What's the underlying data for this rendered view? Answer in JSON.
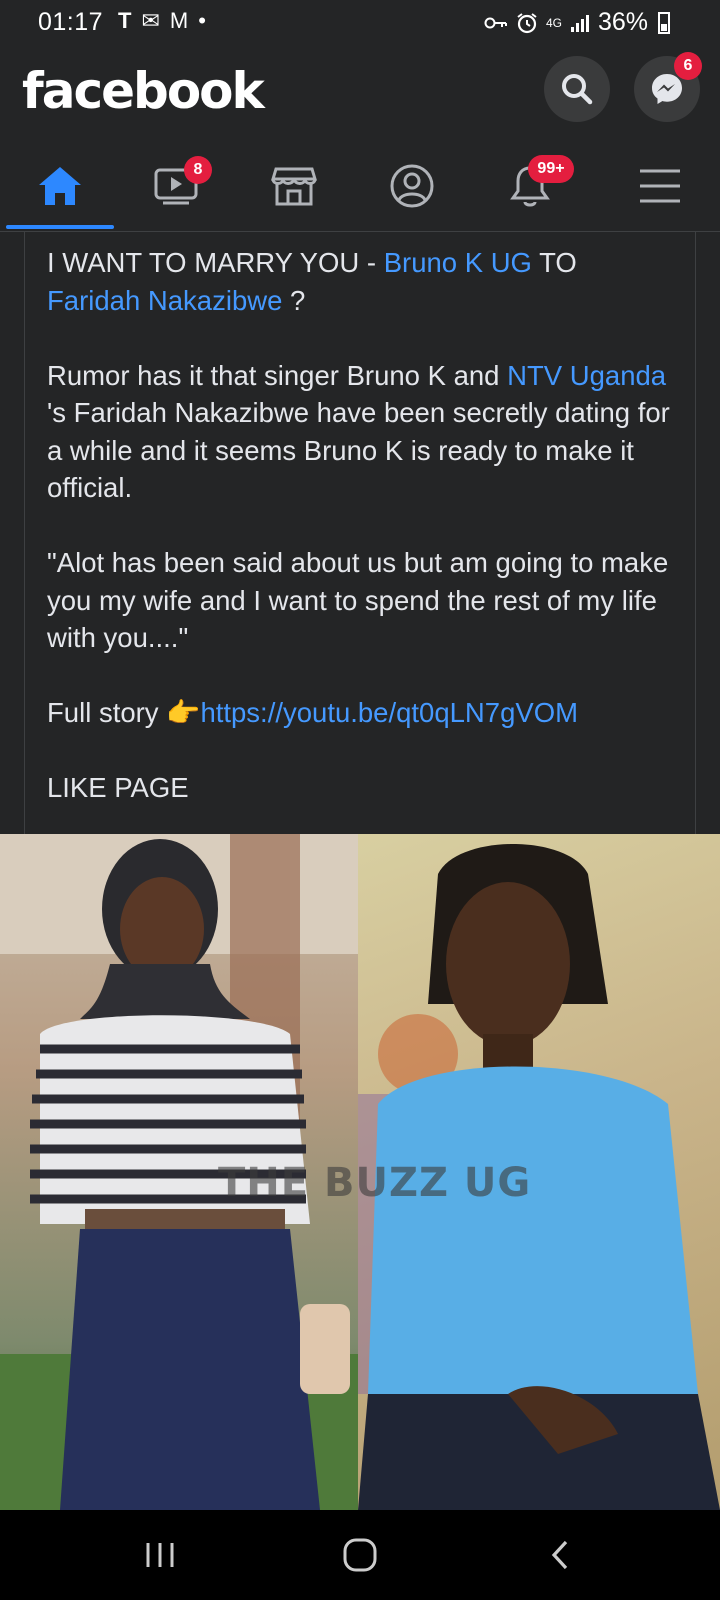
{
  "status_bar": {
    "time": "01:17",
    "notification_glyphs": [
      "T",
      "✉",
      "M",
      "•"
    ],
    "network": "4G",
    "battery_percent": "36%"
  },
  "header": {
    "logo": "facebook",
    "messenger_badge": "6"
  },
  "tabs": {
    "video_badge": "8",
    "notifications_badge": "99+"
  },
  "post": {
    "line1_prefix": "I WANT TO MARRY YOU - ",
    "mention_1": "Bruno K UG",
    "line1_to": " TO",
    "mention_2": "Faridah Nakazibwe",
    "line1_suffix": " ?",
    "para2_prefix": "Rumor has it that singer Bruno K and ",
    "mention_3": "NTV Uganda",
    "para2_suffix": " 's Faridah Nakazibwe have been secretly dating for a while and it seems Bruno K is ready to make it official.",
    "quote": "\"Alot has been said about us but am going to make you my wife and I want to spend the rest of my life with you....\"",
    "full_story_label": "Full story ",
    "pointing_emoji": "👉",
    "story_link": "https://youtu.be/qt0qLN7gVOM",
    "cta": "LIKE PAGE"
  },
  "image": {
    "watermark": "THE BUZZ UG"
  },
  "colors": {
    "background": "#242526",
    "link": "#4599ff",
    "active_tab": "#2d88ff",
    "badge": "#e41e3f"
  }
}
